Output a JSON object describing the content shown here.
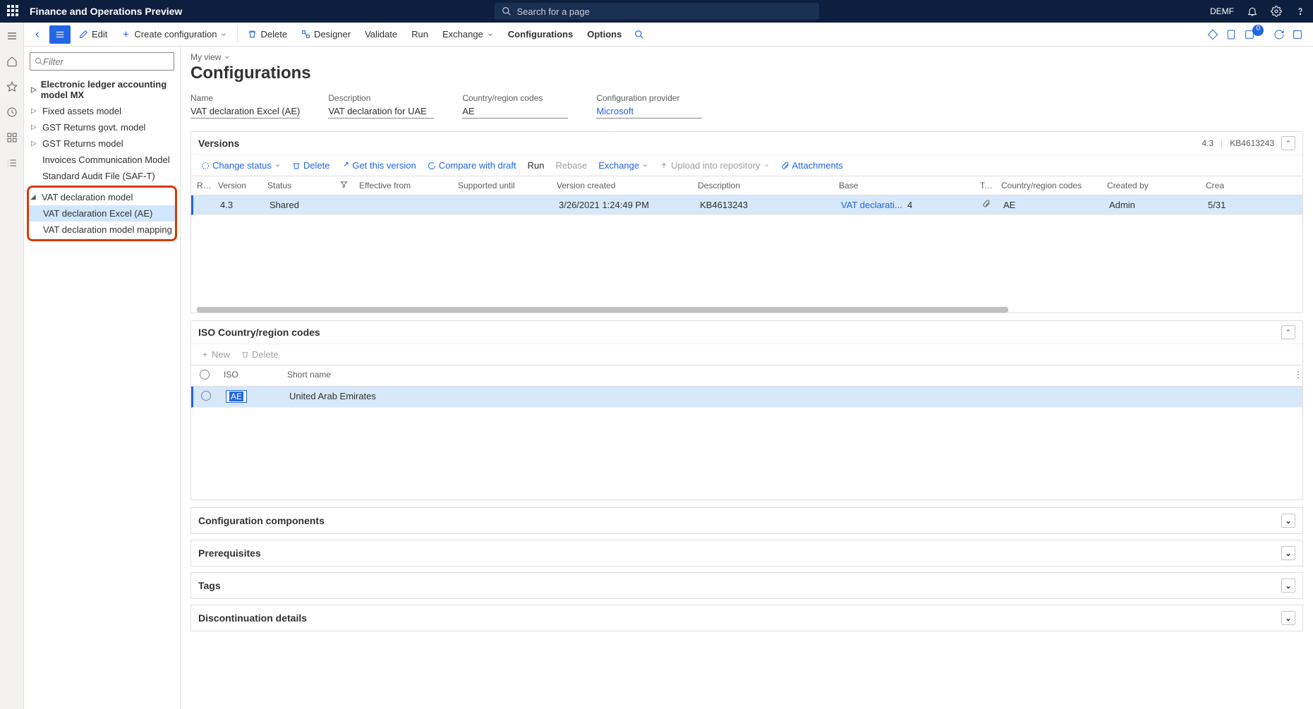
{
  "topbar": {
    "title": "Finance and Operations Preview",
    "search_placeholder": "Search for a page",
    "company": "DEMF"
  },
  "actionbar": {
    "edit": "Edit",
    "create": "Create configuration",
    "delete": "Delete",
    "designer": "Designer",
    "validate": "Validate",
    "run": "Run",
    "exchange": "Exchange",
    "configurations": "Configurations",
    "options": "Options",
    "badge_count": "0"
  },
  "tree": {
    "filter_placeholder": "Filter",
    "items": [
      "Electronic ledger accounting model MX",
      "Fixed assets model",
      "GST Returns govt. model",
      "GST Returns model",
      "Invoices Communication Model",
      "Standard Audit File (SAF-T)"
    ],
    "vat": {
      "parent": "VAT declaration model",
      "child1": "VAT declaration Excel (AE)",
      "child2": "VAT declaration model mapping"
    }
  },
  "page": {
    "myview": "My view",
    "title": "Configurations",
    "fields": {
      "name_label": "Name",
      "name_value": "VAT declaration Excel (AE)",
      "desc_label": "Description",
      "desc_value": "VAT declaration for UAE",
      "region_label": "Country/region codes",
      "region_value": "AE",
      "provider_label": "Configuration provider",
      "provider_value": "Microsoft"
    }
  },
  "versions": {
    "title": "Versions",
    "summary_ver": "4.3",
    "summary_kb": "KB4613243",
    "toolbar": {
      "change": "Change status",
      "delete": "Delete",
      "get": "Get this version",
      "compare": "Compare with draft",
      "run": "Run",
      "rebase": "Rebase",
      "exchange": "Exchange",
      "upload": "Upload into repository",
      "attach": "Attachments"
    },
    "columns": {
      "re": "Re...",
      "version": "Version",
      "status": "Status",
      "eff": "Effective from",
      "supp": "Supported until",
      "created": "Version created",
      "desc": "Description",
      "base": "Base",
      "te": "Te...",
      "region": "Country/region codes",
      "by": "Created by",
      "createdon": "Crea"
    },
    "row": {
      "version": "4.3",
      "status": "Shared",
      "created": "3/26/2021 1:24:49 PM",
      "desc": "KB4613243",
      "base": "VAT declarati...",
      "base2": "4",
      "region": "AE",
      "by": "Admin",
      "createdon": "5/31"
    }
  },
  "iso": {
    "title": "ISO Country/region codes",
    "new": "New",
    "delete": "Delete",
    "col_iso": "ISO",
    "col_short": "Short name",
    "row_iso": "AE",
    "row_short": "United Arab Emirates"
  },
  "collapsed": {
    "components": "Configuration components",
    "prereq": "Prerequisites",
    "tags": "Tags",
    "discont": "Discontinuation details"
  }
}
